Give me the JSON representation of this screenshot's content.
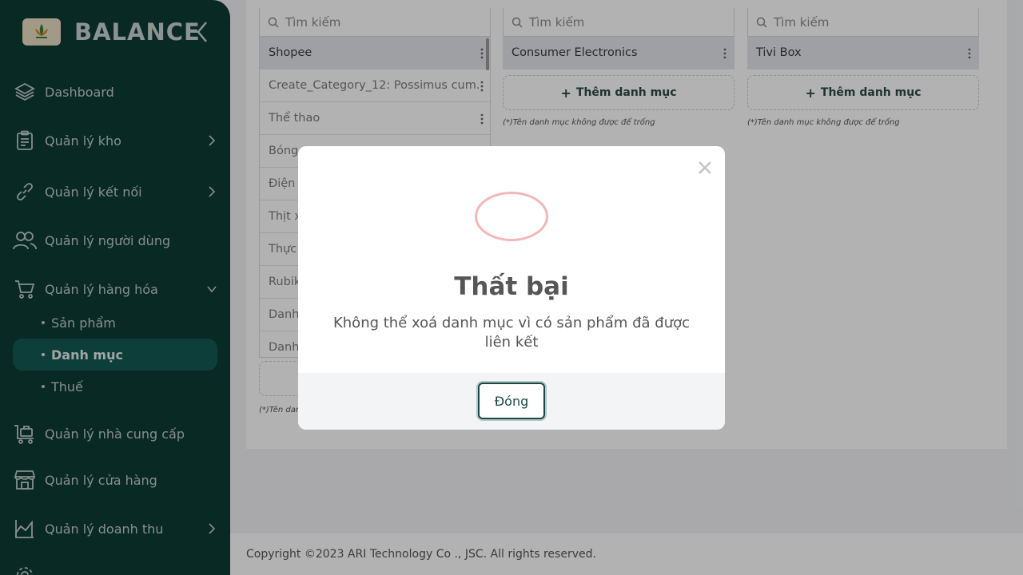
{
  "brand": {
    "name": "BALANCE"
  },
  "sidebar": {
    "items": [
      {
        "label": "Dashboard",
        "icon": "layers-icon"
      },
      {
        "label": "Quản lý kho",
        "icon": "clipboard-icon"
      },
      {
        "label": "Quản lý kết nối",
        "icon": "link-icon"
      },
      {
        "label": "Quản lý người dùng",
        "icon": "users-icon"
      },
      {
        "label": "Quản lý hàng hóa",
        "icon": "cart-icon"
      },
      {
        "label": "Quản lý nhà cung cấp",
        "icon": "supplier-cart-icon"
      },
      {
        "label": "Quản lý cửa hàng",
        "icon": "store-icon"
      },
      {
        "label": "Quản lý doanh thu",
        "icon": "revenue-chart-icon"
      }
    ],
    "sub_items": [
      {
        "label": "Sản phẩm"
      },
      {
        "label": "Danh mục"
      },
      {
        "label": "Thuế"
      }
    ]
  },
  "columns": [
    {
      "search_placeholder": "Tìm kiếm",
      "rows": [
        "Shopee",
        "Create_Category_12: Possimus cum.",
        "Thể thao",
        "Bóng",
        "Điện t",
        "Thịt x",
        "Thực p",
        "Rubik",
        "Danh",
        "Danh"
      ],
      "hint": "(*)Tên dan"
    },
    {
      "search_placeholder": "Tìm kiếm",
      "rows": [
        "Consumer Electronics"
      ],
      "add_label": "Thêm danh mục",
      "hint": "(*)Tên danh mục không được để trống"
    },
    {
      "search_placeholder": "Tìm kiếm",
      "rows": [
        "Tivi Box"
      ],
      "add_label": "Thêm danh mục",
      "hint": "(*)Tên danh mục không được để trống"
    }
  ],
  "footer": {
    "copyright": "Copyright ©2023 ARI Technology Co ., JSC. All rights reserved."
  },
  "modal": {
    "title": "Thất bại",
    "message": "Không thể xoá danh mục vì có sản phẩm đã được liên kết",
    "ok_label": "Đóng"
  },
  "colors": {
    "sidebar_bg": "#0e3b36",
    "active_bg": "#135a52",
    "error_ring": "#f2b7b6",
    "primary_btn_border": "#184a45"
  }
}
